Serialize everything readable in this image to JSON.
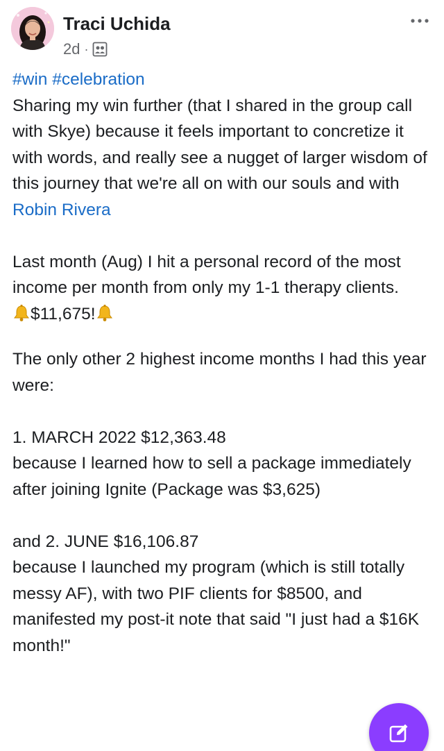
{
  "post": {
    "author_name": "Traci Uchida",
    "timestamp": "2d",
    "meta_separator": "·",
    "audience_icon": "group-icon",
    "hashtags": [
      "#win",
      "#celebration"
    ],
    "paragraph1_text": "Sharing my win further (that I shared in the group call with Skye) because it feels important to concretize it with words, and really see a nugget of larger wisdom of this journey that we're all on with our souls and with ",
    "mention": "Robin Rivera",
    "paragraph2_line1": "Last month (Aug) I hit a personal record of the most income per month from only my 1-1 therapy clients.",
    "record_amount": "$11,675!",
    "paragraph3": "The only other 2 highest income months I had this year were:",
    "item1_title": "1. MARCH 2022 $12,363.48",
    "item1_detail": "because I learned how to sell a package immediately after joining Ignite (Package was $3,625)",
    "item2_title": "and 2. JUNE $16,106.87",
    "item2_detail": "because I launched my program (which is still totally messy AF), with two PIF clients for $8500, and manifested my post-it note that said \"I just had a $16K month!\""
  },
  "icons": {
    "more": "more-options-icon",
    "bell": "bell-icon",
    "compose": "compose-icon"
  },
  "colors": {
    "link": "#1a6cc7",
    "fab": "#8b3dff",
    "secondary_text": "#65676b"
  }
}
